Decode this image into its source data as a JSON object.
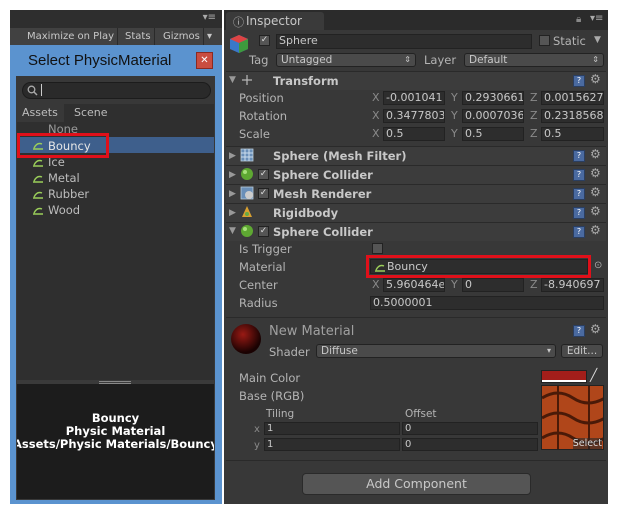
{
  "game_view": {
    "menu_icon": "list-icon",
    "toolbar": [
      "Maximize on Play",
      "Stats",
      "Gizmos"
    ]
  },
  "select_window": {
    "title": "Select PhysicMaterial",
    "close_icon": "close-icon",
    "search": {
      "value": "",
      "placeholder": ""
    },
    "tabs": [
      "Assets",
      "Scene"
    ],
    "items": [
      {
        "label": "None",
        "icon": ""
      },
      {
        "label": "Bouncy",
        "icon": "physic-material-icon",
        "selected": true
      },
      {
        "label": "Ice",
        "icon": "physic-material-icon"
      },
      {
        "label": "Metal",
        "icon": "physic-material-icon"
      },
      {
        "label": "Rubber",
        "icon": "physic-material-icon"
      },
      {
        "label": "Wood",
        "icon": "physic-material-icon"
      }
    ],
    "preview": {
      "name": "Bouncy",
      "type": "Physic Material",
      "path": "Assets/Physic Materials/Bouncy"
    }
  },
  "inspector": {
    "tab_label": "Inspector",
    "object": {
      "name": "Sphere",
      "static_label": "Static",
      "tag_label": "Tag",
      "tag_value": "Untagged",
      "layer_label": "Layer",
      "layer_value": "Default"
    },
    "transform": {
      "title": "Transform",
      "position_label": "Position",
      "position": {
        "x": "-0.001041",
        "y": "0.2930661",
        "z": "0.0015627"
      },
      "rotation_label": "Rotation",
      "rotation": {
        "x": "0.3477803",
        "y": "0.0007036",
        "z": "0.2318568"
      },
      "scale_label": "Scale",
      "scale": {
        "x": "0.5",
        "y": "0.5",
        "z": "0.5"
      }
    },
    "components": [
      {
        "title": "Sphere (Mesh Filter)",
        "checkbox": false
      },
      {
        "title": "Sphere Collider",
        "checkbox": true
      },
      {
        "title": "Mesh Renderer",
        "checkbox": true
      },
      {
        "title": "Rigidbody",
        "checkbox": false
      }
    ],
    "sphere_collider": {
      "title": "Sphere Collider",
      "is_trigger_label": "Is Trigger",
      "material_label": "Material",
      "material_value": "Bouncy",
      "center_label": "Center",
      "center": {
        "x": "5.960464e",
        "y": "0",
        "z": "-8.940697"
      },
      "radius_label": "Radius",
      "radius": "0.5000001"
    },
    "material": {
      "name": "New Material",
      "shader_label": "Shader",
      "shader_value": "Diffuse",
      "edit_label": "Edit...",
      "main_color_label": "Main Color",
      "main_color": "#a31e1a",
      "base_label": "Base (RGB)",
      "tiling_label": "Tiling",
      "offset_label": "Offset",
      "tiling": {
        "x": "1",
        "y": "1"
      },
      "offset": {
        "x": "0",
        "y": "0"
      },
      "select_label": "Select"
    },
    "add_component_label": "Add Component",
    "axis": {
      "x": "X",
      "y": "Y",
      "z": "Z",
      "lx": "x",
      "ly": "y"
    }
  }
}
